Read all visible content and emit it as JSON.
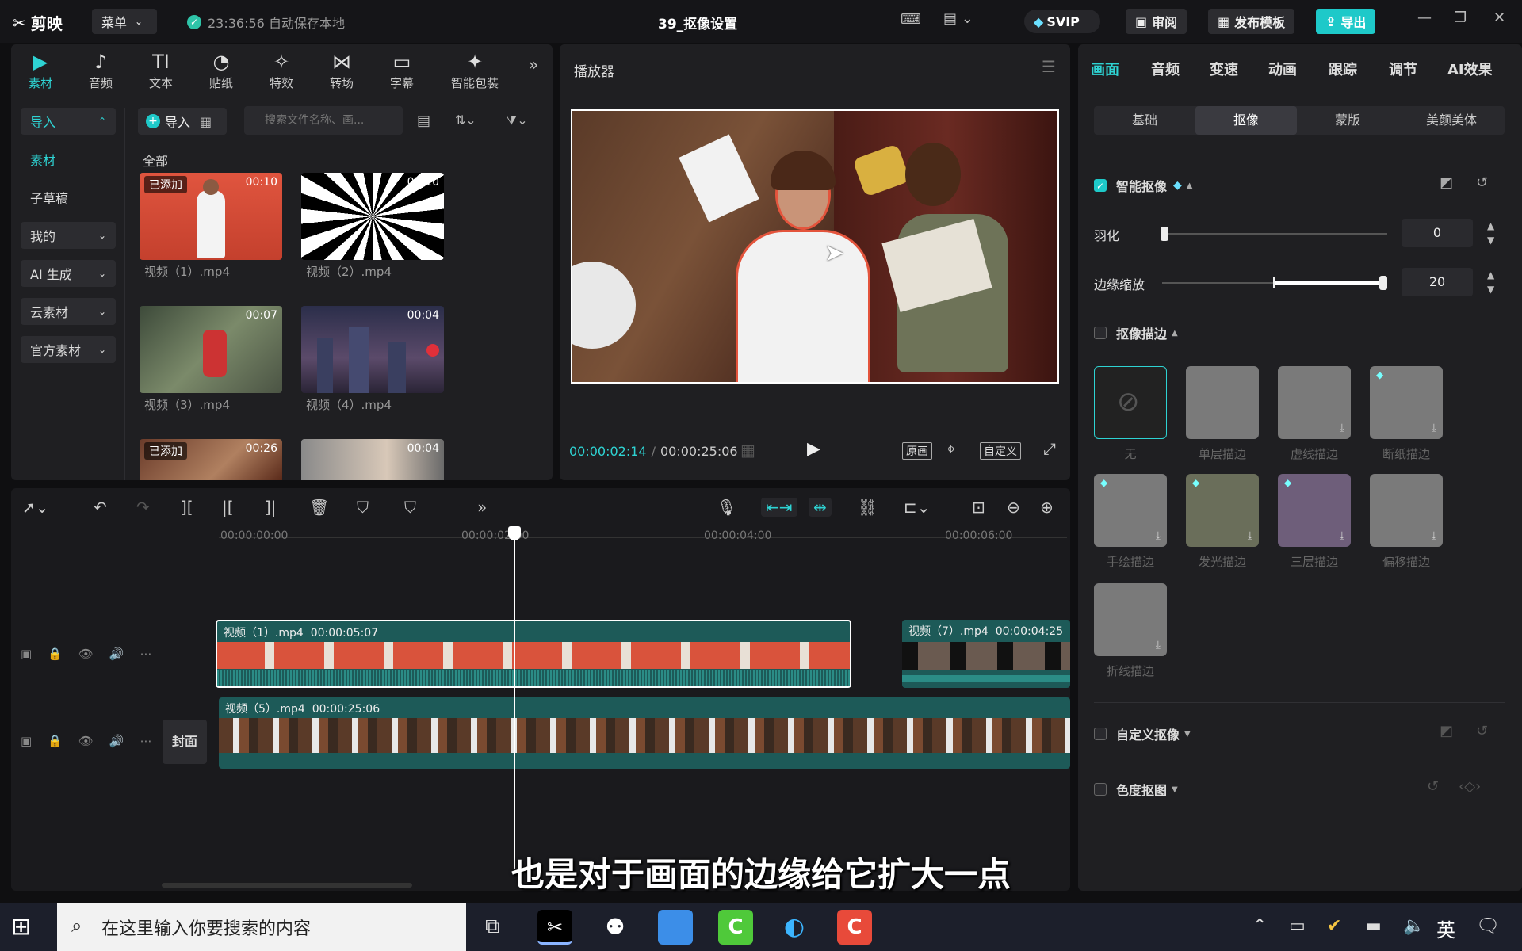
{
  "titlebar": {
    "logo": "剪映",
    "menu_label": "菜单",
    "autosave": "23:36:56 自动保存本地",
    "doc_title": "39_抠像设置",
    "svip": "SVIP",
    "review": "审阅",
    "publish_template": "发布模板",
    "export": "导出"
  },
  "media": {
    "tabs": [
      {
        "label": "素材",
        "icon": "media-icon"
      },
      {
        "label": "音频",
        "icon": "audio-icon"
      },
      {
        "label": "文本",
        "icon": "text-icon"
      },
      {
        "label": "贴纸",
        "icon": "sticker-icon"
      },
      {
        "label": "特效",
        "icon": "effect-icon"
      },
      {
        "label": "转场",
        "icon": "transition-icon"
      },
      {
        "label": "字幕",
        "icon": "subtitle-icon"
      },
      {
        "label": "智能包装",
        "icon": "smart-pack-icon"
      }
    ],
    "sidebar": [
      {
        "label": "导入"
      },
      {
        "label": "素材"
      },
      {
        "label": "子草稿"
      },
      {
        "label": "我的"
      },
      {
        "label": "AI 生成"
      },
      {
        "label": "云素材"
      },
      {
        "label": "官方素材"
      }
    ],
    "import_button": "导入",
    "search_placeholder": "搜索文件名称、画...",
    "all_label": "全部",
    "added_tag": "已添加",
    "items": [
      {
        "label": "视频（1）.mp4",
        "duration": "00:10"
      },
      {
        "label": "视频（2）.mp4",
        "duration": "00:10"
      },
      {
        "label": "视频（3）.mp4",
        "duration": "00:07"
      },
      {
        "label": "视频（4）.mp4",
        "duration": "00:04"
      },
      {
        "label": "",
        "duration": "00:26"
      },
      {
        "label": "",
        "duration": "00:04"
      }
    ]
  },
  "player": {
    "title": "播放器",
    "current_time": "00:00:02:14",
    "total_time": "00:00:25:06",
    "original": "原画",
    "custom": "自定义"
  },
  "props": {
    "tabs": [
      "画面",
      "音频",
      "变速",
      "动画",
      "跟踪",
      "调节",
      "AI效果"
    ],
    "subtabs": [
      "基础",
      "抠像",
      "蒙版",
      "美颜美体"
    ],
    "smart_cutout": "智能抠像",
    "feather_label": "羽化",
    "feather_value": "0",
    "feather_level": 0,
    "edge_label": "边缘缩放",
    "edge_value": "20",
    "edge_level": 1.0,
    "stroke_title": "抠像描边",
    "strokes": [
      "无",
      "单层描边",
      "虚线描边",
      "断纸描边",
      "手绘描边",
      "发光描边",
      "三层描边",
      "偏移描边",
      "折线描边"
    ],
    "custom_cutout": "自定义抠像",
    "chroma_key": "色度抠图"
  },
  "timeline": {
    "ruler": [
      "00:00:00:00",
      "00:00:02:00",
      "00:00:04:00",
      "00:00:06:00"
    ],
    "clip1_label": "视频（1）.mp4",
    "clip1_time": "00:00:05:07",
    "clip7_label": "视频（7）.mp4",
    "clip7_time": "00:00:04:25",
    "clip5_label": "视频（5）.mp4",
    "clip5_time": "00:00:25:06",
    "cover": "封面"
  },
  "subtitle": "也是对于画面的边缘给它扩大一点",
  "taskbar": {
    "search_placeholder": "在这里输入你要搜索的内容",
    "ime": "英"
  }
}
